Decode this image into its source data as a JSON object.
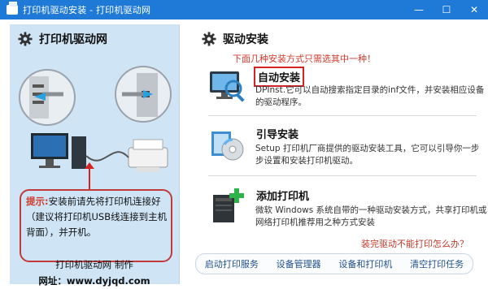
{
  "window": {
    "title": "打印机驱动安装 - 打印机驱动网",
    "controls": [
      "—",
      "☐",
      "✕"
    ]
  },
  "left": {
    "header_title": "打印机驱动网",
    "hint_label": "提示:",
    "hint_text": "安装前请先将打印机连接好（建议将打印机USB线连接到主机背面），并开机。",
    "footer_line1": "打印机驱动网 制作",
    "footer_line2": "网址：www.dyjqd.com"
  },
  "right": {
    "header_title": "驱动安装",
    "notice": "下面几种安装方式只需选其中一种！",
    "options": [
      {
        "title": "自动安装",
        "desc": "DPInst.它可以自动搜索指定目录的inf文件，并安装相应设备的驱动程序。",
        "icon": "monitor-search-icon"
      },
      {
        "title": "引导安装",
        "desc": "Setup 打印机厂商提供的驱动安装工具，它可以引导你一步步设置和安装打印机驱动。",
        "icon": "setup-disc-icon"
      },
      {
        "title": "添加打印机",
        "desc": "微软 Windows 系统自带的一种驱动安装方式，共享打印机或网络打印机推荐用之种方式安装",
        "icon": "add-printer-icon"
      }
    ],
    "help_link": "装完驱动不能打印怎么办？",
    "bottom_buttons": [
      "启动打印服务",
      "设备管理器",
      "设备和打印机",
      "清空打印任务"
    ]
  },
  "colors": {
    "titlebar": "#1e7ad6",
    "panel": "#cfe5f6",
    "accent_red": "#d42323"
  }
}
